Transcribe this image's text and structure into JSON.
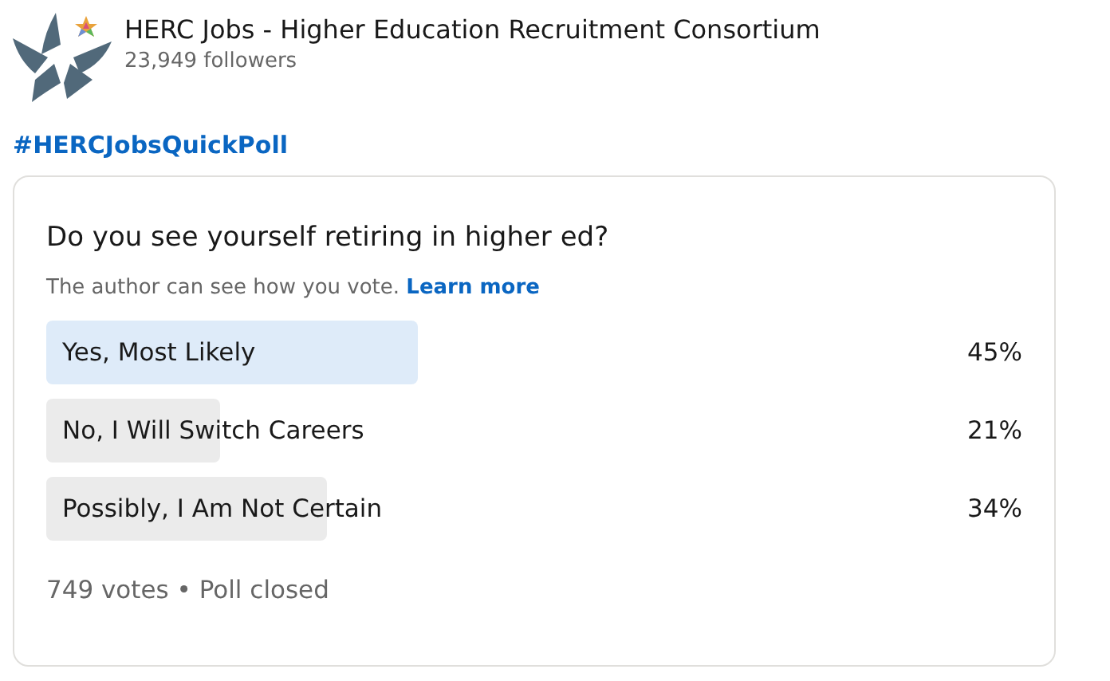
{
  "page": {
    "name": "HERC Jobs - Higher Education Recruitment Consortium",
    "followers": "23,949 followers"
  },
  "hashtag": "#HERCJobsQuickPoll",
  "poll": {
    "question": "Do you see yourself retiring in higher ed?",
    "note": "The author can see how you vote.",
    "note_link": "Learn more",
    "options": [
      {
        "label": "Yes, Most Likely",
        "percent": "45%",
        "selected": true
      },
      {
        "label": "No, I Will Switch Careers",
        "percent": "21%",
        "selected": false
      },
      {
        "label": "Possibly, I Am Not Certain",
        "percent": "34%",
        "selected": false
      }
    ],
    "footer": "749 votes • Poll closed"
  }
}
